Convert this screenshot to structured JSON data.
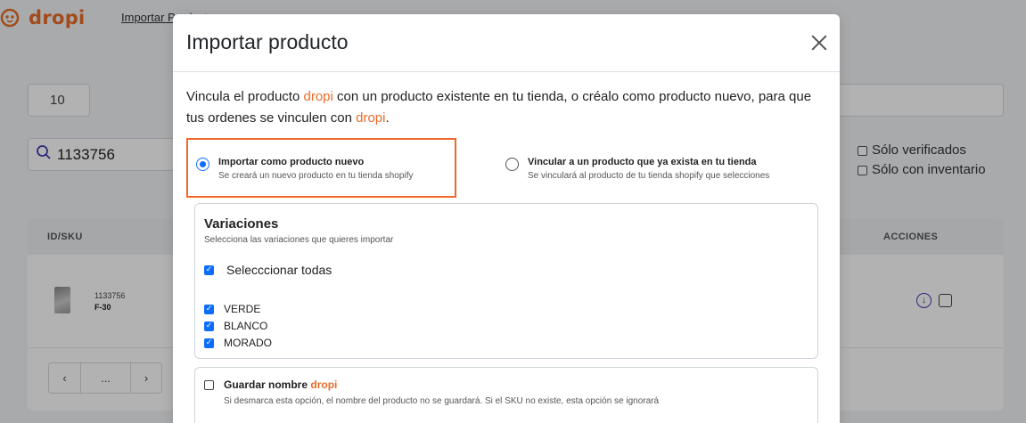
{
  "app": {
    "brand": "dropi",
    "nav_link": "Importar Productos",
    "per_page": "10",
    "search_value": "1133756",
    "filters": [
      "Sólo verificados",
      "Sólo con inventario"
    ],
    "table": {
      "headers": {
        "id": "ID/SKU",
        "actions": "ACCIONES"
      },
      "rows": [
        {
          "id": "1133756",
          "sku": "F-30"
        }
      ]
    },
    "pager": {
      "prev": "‹",
      "ellipsis": "...",
      "next": "›"
    }
  },
  "modal": {
    "title": "Importar producto",
    "intro": {
      "part1": "Vincula el producto ",
      "brand1": "dropi",
      "part2": " con un producto existente en tu tienda, o créalo como producto nuevo, para que tus ordenes se vinculen con ",
      "brand2": "dropi",
      "part3": "."
    },
    "options": [
      {
        "title": "Importar como producto nuevo",
        "subtitle": "Se creará un nuevo producto en tu tienda shopify",
        "selected": true
      },
      {
        "title": "Vincular a un producto que ya exista en tu tienda",
        "subtitle": "Se vinculará al producto de tu tienda shopify que selecciones",
        "selected": false
      }
    ],
    "variations": {
      "title": "Variaciones",
      "subtitle": "Selecciona las variaciones que quieres importar",
      "select_all": "Selecccionar todas",
      "items": [
        "VERDE",
        "BLANCO",
        "MORADO"
      ]
    },
    "keep_name": {
      "label": "Guardar nombre ",
      "brand": "dropi",
      "subtitle": "Si desmarca esta opción, el nombre del producto no se guardará. Si el SKU no existe, esta opción se ignorará"
    }
  },
  "colors": {
    "brand": "#e86c28",
    "primary": "#0d6efd",
    "highlight": "#f0692c"
  }
}
